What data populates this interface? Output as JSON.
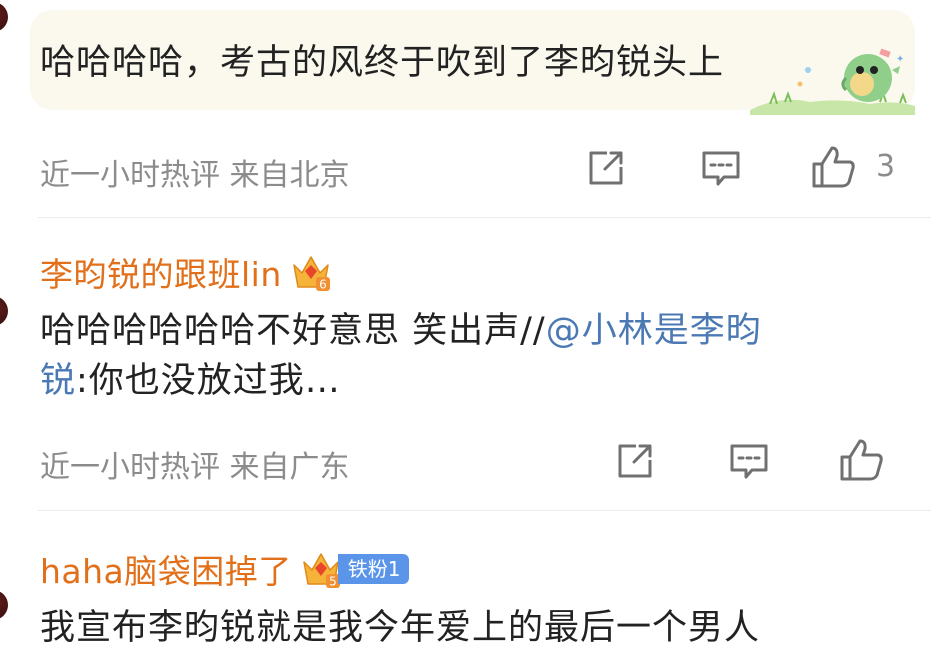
{
  "comments": [
    {
      "text": "哈哈哈哈，考古的风终于吹到了李昀锐头上",
      "meta": "近一小时热评  来自北京",
      "likes": "3"
    },
    {
      "username": "李昀锐的跟班lin",
      "level": "6",
      "text_prefix": "哈哈哈哈哈哈不好意思    笑出声//",
      "mention_line1": "@小林是李昀",
      "mention_line2": "锐",
      "text_suffix": ":你也没放过我…",
      "meta": "近一小时热评  来自广东"
    },
    {
      "username": "haha脑袋困掉了",
      "level": "5",
      "fan_badge": "铁粉1",
      "text": "我宣布李昀锐就是我今年爱上的最后一个男人"
    }
  ],
  "colors": {
    "username": "#e2701a",
    "mention": "#4a79b3",
    "meta": "#8c8c8c",
    "bubble": "#fbf9ee",
    "fan_badge": "#5a95ea"
  },
  "icons": [
    "share-icon",
    "comment-icon",
    "like-icon",
    "crown-badge-icon"
  ]
}
